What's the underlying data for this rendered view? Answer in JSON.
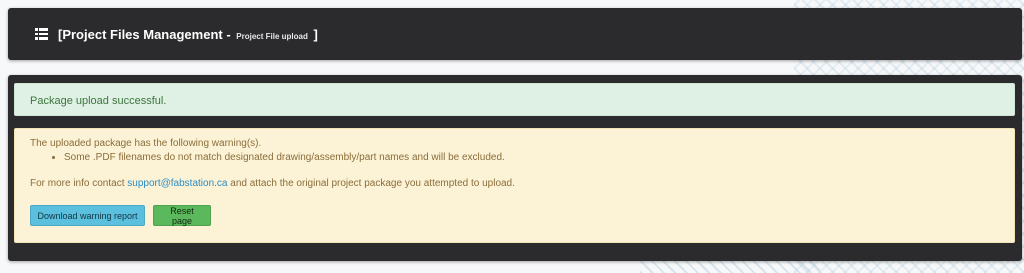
{
  "header": {
    "icon": "list-icon",
    "title_open": "[Project Files Management - ",
    "subtitle": "Project File upload",
    "title_close": " ]"
  },
  "success_alert": {
    "message": "Package upload successful."
  },
  "warning_alert": {
    "intro": "The uploaded package has the following warning(s).",
    "warnings": [
      "Some .PDF filenames do not match designated drawing/assembly/part names and will be excluded."
    ],
    "contact_prefix": "For more info contact ",
    "contact_email": "support@fabstation.ca",
    "contact_suffix": " and attach the original project package you attempted to upload."
  },
  "buttons": {
    "download_label": "Download warning report",
    "reset_label": "Reset page"
  },
  "colors": {
    "panel": "#2b2b2d",
    "success_bg": "#dff0e4",
    "warning_bg": "#fcf3d6",
    "info_button": "#5bc0de",
    "success_button": "#5cb85c",
    "link": "#2a8bc4"
  }
}
